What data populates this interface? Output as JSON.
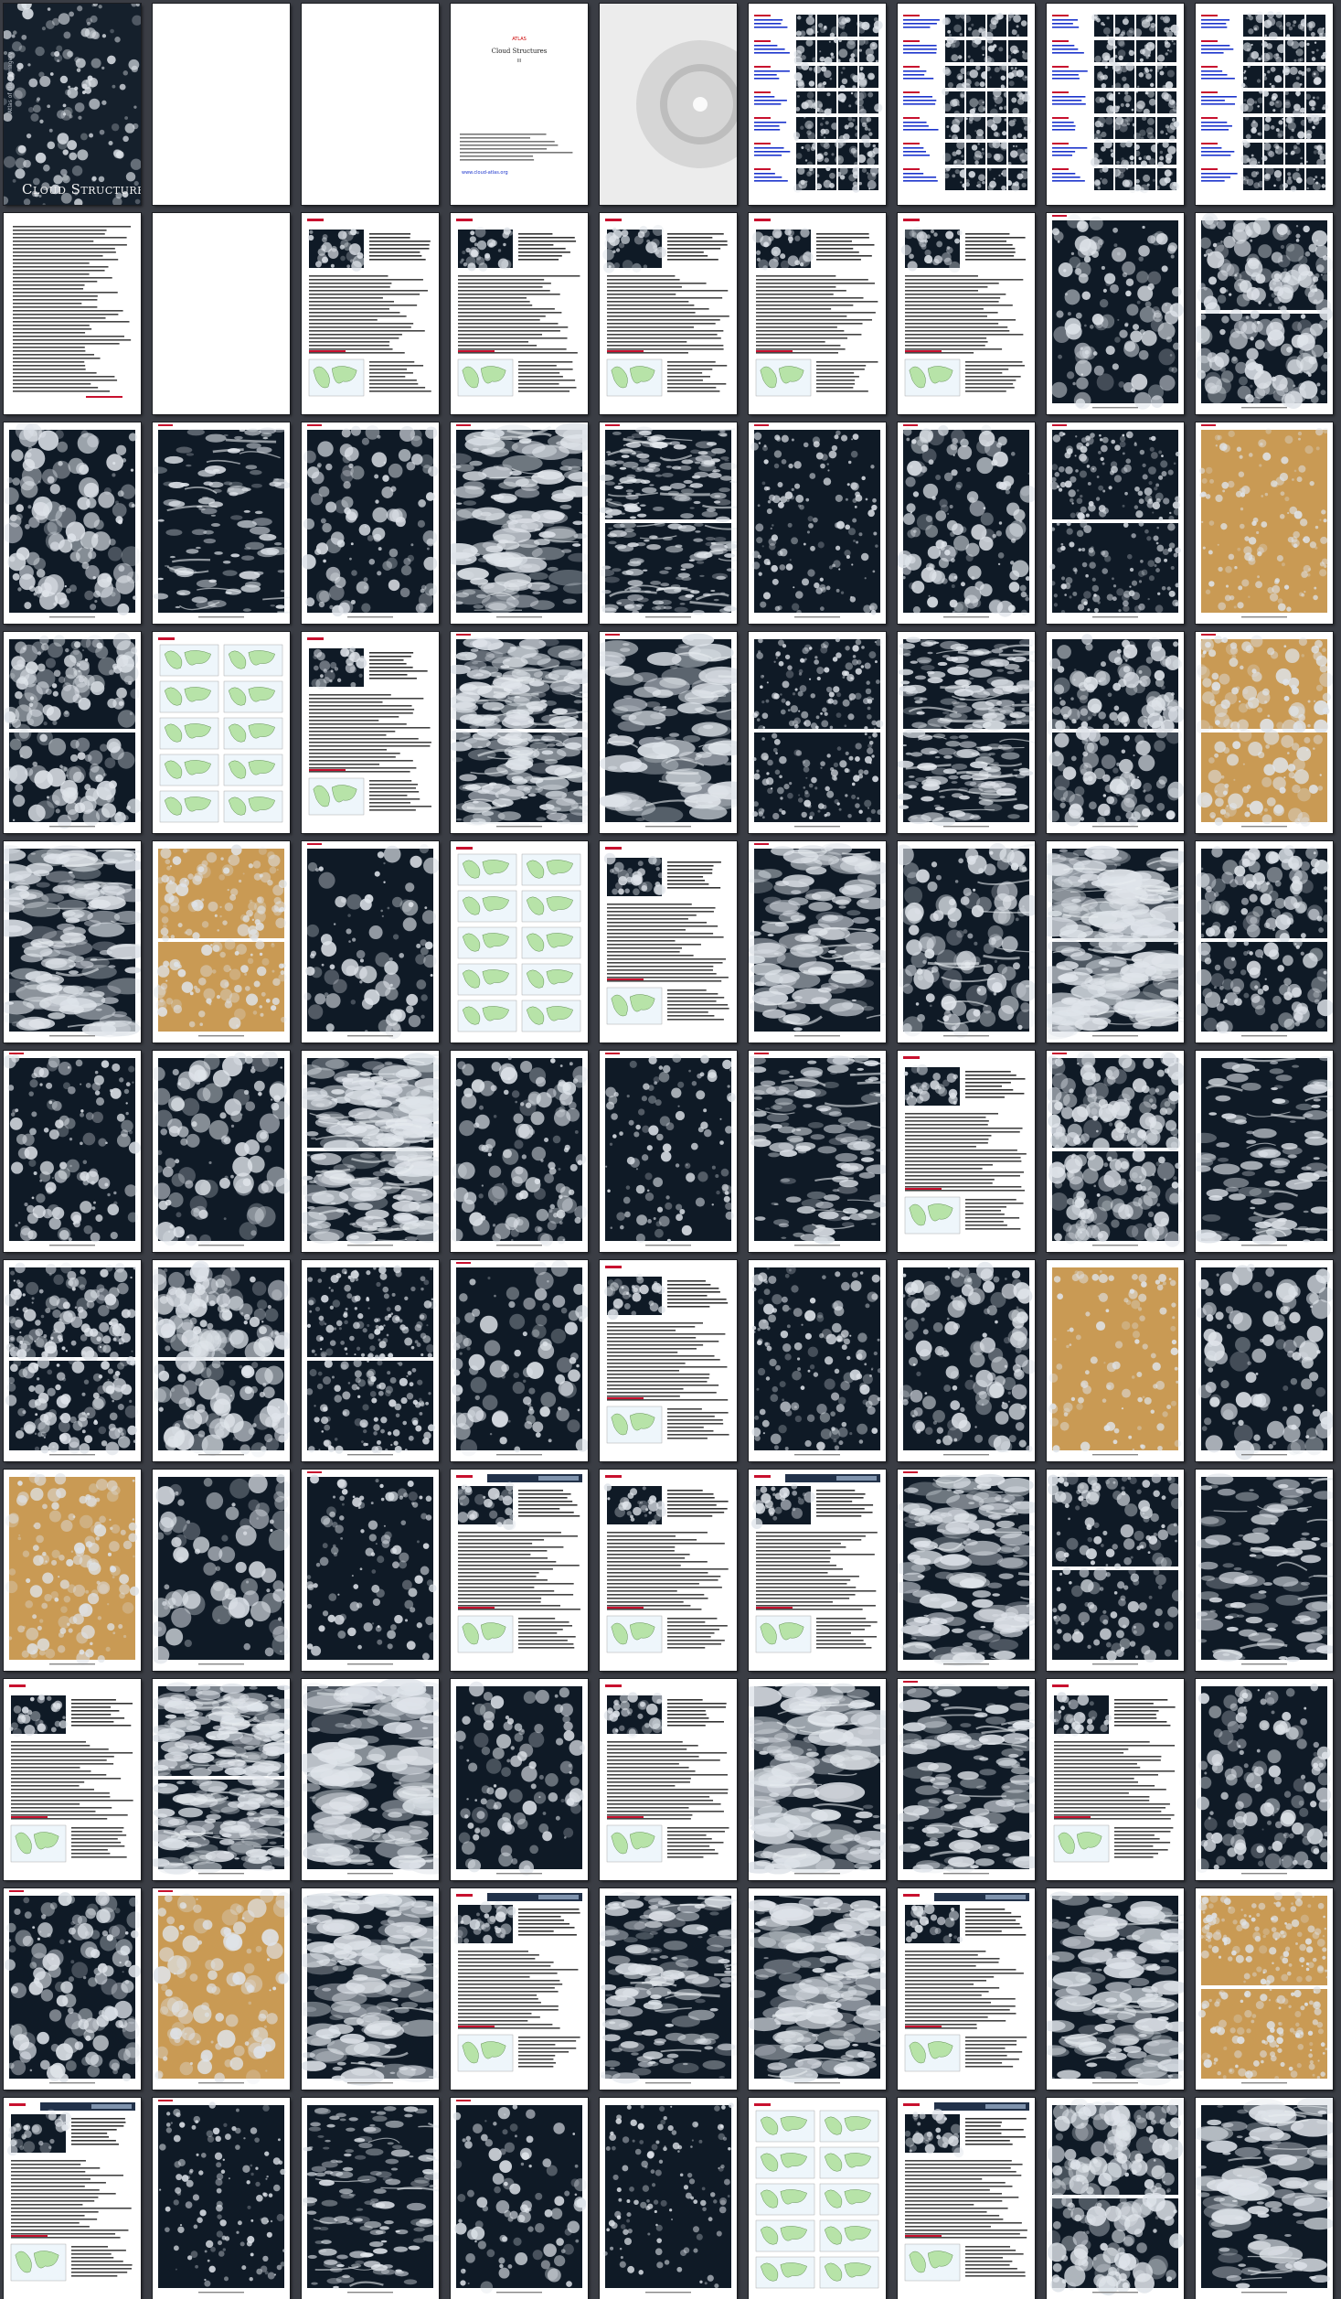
{
  "document": {
    "cover_title": "Cloud Structures",
    "cover_side_text": "Atlas of cloud imagery",
    "title_page": {
      "tag": "ATLAS",
      "title": "Cloud Structures",
      "number": "III",
      "link": "www.cloud-atlas.org"
    }
  },
  "grid": {
    "columns": 9,
    "rows": 11,
    "page_count": 99
  },
  "page_types": [
    "cover",
    "blank",
    "blank",
    "title",
    "grey",
    "toc",
    "toc",
    "toc",
    "toc",
    "text",
    "blank",
    "textimg",
    "textimg",
    "textimg",
    "textimg",
    "textimg",
    "photo",
    "photo",
    "photo",
    "photo",
    "photo",
    "photo",
    "photo",
    "photo",
    "photo",
    "photo",
    "photo",
    "photo",
    "maps",
    "textimg",
    "photo",
    "photo",
    "photo",
    "photo",
    "photo",
    "photo",
    "photo",
    "photo",
    "photo",
    "maps",
    "textimg",
    "photo",
    "photo",
    "photo",
    "photo",
    "photo",
    "photo",
    "photo",
    "photo",
    "photo",
    "photo",
    "textimg",
    "photo",
    "photo",
    "photo",
    "photo",
    "photo",
    "photo",
    "textimg",
    "photo",
    "photo",
    "photo",
    "photo",
    "photo",
    "photo",
    "photo",
    "textimg",
    "textimg",
    "textimg",
    "photo",
    "photo",
    "photo",
    "textimg",
    "photo",
    "photo",
    "photo",
    "textimg",
    "photo",
    "photo",
    "textimg",
    "photo",
    "photo",
    "photo",
    "photo",
    "textimg",
    "photo",
    "photo",
    "textimg",
    "photo",
    "photo",
    "textimg",
    "photo",
    "photo",
    "photo",
    "photo",
    "maps",
    "textimg",
    "photo",
    "photo"
  ],
  "colors": {
    "viewer_bg": "#3a3d44",
    "cloud": "#dfe4ea",
    "ocean": "#0f1a26",
    "map_land": "#b7e3a8",
    "header_red": "#c8102e",
    "link_blue": "#1a33cc",
    "desert": "#c99a54"
  }
}
